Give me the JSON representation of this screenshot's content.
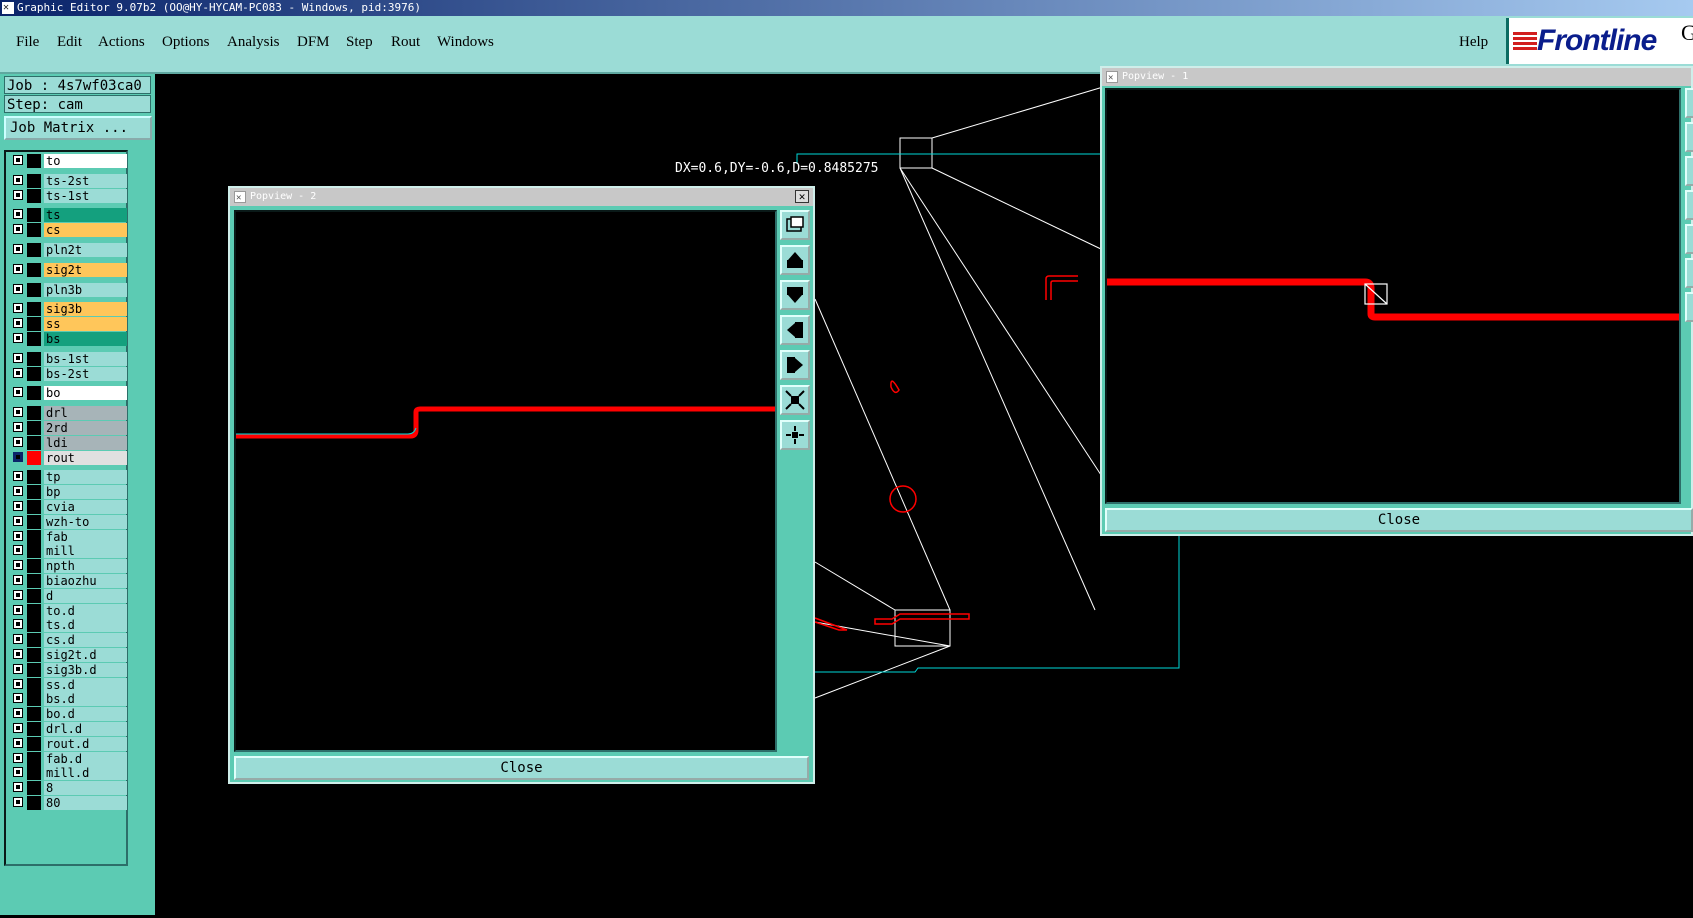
{
  "window": {
    "title": "Graphic Editor 9.07b2 (OO@HY-HYCAM-PC083 - Windows, pid:3976)"
  },
  "menu": {
    "file": "File",
    "edit": "Edit",
    "actions": "Actions",
    "options": "Options",
    "analysis": "Analysis",
    "dfm": "DFM",
    "step": "Step",
    "rout": "Rout",
    "windows": "Windows",
    "help": "Help"
  },
  "logo": {
    "text": "Frontline",
    "suffix": "G"
  },
  "job": {
    "job_label": "Job : 4s7wf03ca0",
    "step_label": "Step: cam",
    "matrix_button": "Job Matrix ..."
  },
  "layers": [
    {
      "name": "to",
      "color": "#ffffff"
    },
    {
      "name": "ts-2st",
      "color": "#9bdcd6"
    },
    {
      "name": "ts-1st",
      "color": "#9bdcd6"
    },
    {
      "name": "ts",
      "color": "#14a07e"
    },
    {
      "name": "cs",
      "color": "#ffc65a"
    },
    {
      "name": "pln2t",
      "color": "#9bdcd6"
    },
    {
      "name": "sig2t",
      "color": "#ffc65a"
    },
    {
      "name": "pln3b",
      "color": "#9bdcd6"
    },
    {
      "name": "sig3b",
      "color": "#ffc65a"
    },
    {
      "name": "ss",
      "color": "#ffc65a"
    },
    {
      "name": "bs",
      "color": "#14a07e"
    },
    {
      "name": "bs-1st",
      "color": "#9bdcd6"
    },
    {
      "name": "bs-2st",
      "color": "#9bdcd6"
    },
    {
      "name": "bo",
      "color": "#ffffff"
    },
    {
      "name": "drl",
      "color": "#a7b4b8"
    },
    {
      "name": "2rd",
      "color": "#a7b4b8"
    },
    {
      "name": "ldi",
      "color": "#a7b4b8"
    },
    {
      "name": "rout",
      "color": "#e0e0e0",
      "active": true
    },
    {
      "name": "tp",
      "color": "#9bdcd6"
    },
    {
      "name": "bp",
      "color": "#9bdcd6"
    },
    {
      "name": "cvia",
      "color": "#9bdcd6"
    },
    {
      "name": "wzh-to",
      "color": "#9bdcd6"
    },
    {
      "name": "fab",
      "color": "#9bdcd6"
    },
    {
      "name": "mill",
      "color": "#9bdcd6"
    },
    {
      "name": "npth",
      "color": "#9bdcd6"
    },
    {
      "name": "biaozhu",
      "color": "#9bdcd6"
    },
    {
      "name": "d",
      "color": "#9bdcd6"
    },
    {
      "name": "to.d",
      "color": "#9bdcd6"
    },
    {
      "name": "ts.d",
      "color": "#9bdcd6"
    },
    {
      "name": "cs.d",
      "color": "#9bdcd6"
    },
    {
      "name": "sig2t.d",
      "color": "#9bdcd6"
    },
    {
      "name": "sig3b.d",
      "color": "#9bdcd6"
    },
    {
      "name": "ss.d",
      "color": "#9bdcd6"
    },
    {
      "name": "bs.d",
      "color": "#9bdcd6"
    },
    {
      "name": "bo.d",
      "color": "#9bdcd6"
    },
    {
      "name": "drl.d",
      "color": "#9bdcd6"
    },
    {
      "name": "rout.d",
      "color": "#9bdcd6"
    },
    {
      "name": "fab.d",
      "color": "#9bdcd6"
    },
    {
      "name": "mill.d",
      "color": "#9bdcd6"
    },
    {
      "name": "8",
      "color": "#9bdcd6"
    },
    {
      "name": "80",
      "color": "#9bdcd6"
    }
  ],
  "canvas": {
    "measure": "DX=0.6,DY=-0.6,D=0.8485275"
  },
  "popview2": {
    "title": "Popview - 2",
    "close_label": "Close"
  },
  "popview1": {
    "title": "Popview - 1",
    "close_label": "Close"
  },
  "colors": {
    "trace": "#ff0000",
    "outline": "#00e0e0",
    "panel": "#5ccbb3",
    "field": "#9bdcd6"
  }
}
